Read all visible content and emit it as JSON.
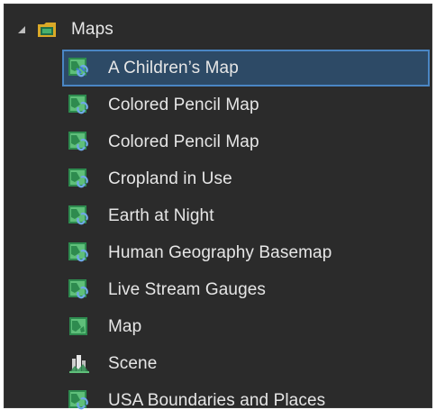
{
  "tree": {
    "folder_label": "Maps",
    "items": [
      {
        "label": "A Children’s Map",
        "icon": "web-map-icon",
        "selected": true
      },
      {
        "label": "Colored Pencil Map",
        "icon": "web-map-icon",
        "selected": false
      },
      {
        "label": "Colored Pencil Map",
        "icon": "web-map-icon",
        "selected": false
      },
      {
        "label": "Cropland in Use",
        "icon": "web-map-icon",
        "selected": false
      },
      {
        "label": "Earth at Night",
        "icon": "web-map-icon",
        "selected": false
      },
      {
        "label": "Human Geography Basemap",
        "icon": "web-map-icon",
        "selected": false
      },
      {
        "label": "Live Stream Gauges",
        "icon": "web-map-icon",
        "selected": false
      },
      {
        "label": "Map",
        "icon": "map-icon",
        "selected": false
      },
      {
        "label": "Scene",
        "icon": "scene-icon",
        "selected": false
      },
      {
        "label": "USA Boundaries and Places",
        "icon": "web-map-icon",
        "selected": false
      }
    ]
  },
  "colors": {
    "background": "#2b2b2b",
    "text": "#e6e6e6",
    "selection_fill": "#2d4a66",
    "selection_border": "#4a86c4",
    "map_icon_green": "#2e8b4f",
    "link_blue": "#3f7fd0"
  }
}
